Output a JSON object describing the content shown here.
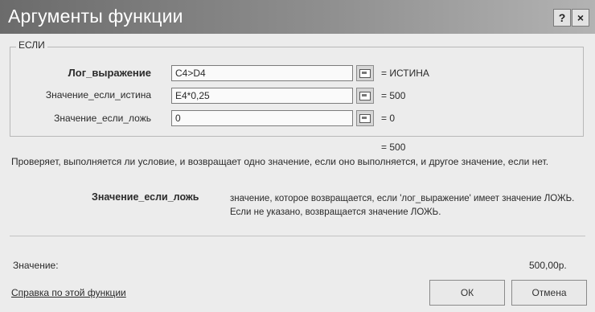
{
  "window": {
    "title": "Аргументы функции",
    "help_glyph": "?",
    "close_glyph": "×"
  },
  "function_group": {
    "name": "ЕСЛИ"
  },
  "arguments": [
    {
      "label": "Лог_выражение",
      "value": "C4>D4",
      "result": "= ИСТИНА",
      "bold": true
    },
    {
      "label": "Значение_если_истина",
      "value": "E4*0,25",
      "result": "= 500",
      "bold": false
    },
    {
      "label": "Значение_если_ложь",
      "value": "0",
      "result": "= 0",
      "bold": false
    }
  ],
  "formula_result": "= 500",
  "description": "Проверяет, выполняется ли условие, и возвращает одно значение, если оно выполняется, и другое значение, если нет.",
  "arg_help": {
    "name": "Значение_если_ложь",
    "text": "значение, которое возвращается, если 'лог_выражение' имеет значение ЛОЖЬ. Если не указано, возвращается значение ЛОЖЬ."
  },
  "value_label": "Значение:",
  "value_result": "500,00р.",
  "help_link": "Справка по этой функции",
  "buttons": {
    "ok": "ОК",
    "cancel": "Отмена"
  },
  "icons": {
    "collapse": "collapse-dialog-icon"
  },
  "colors": {
    "titlebar_dark": "#6b6b6b",
    "titlebar_light": "#b3b3b3",
    "dialog_bg": "#ececec"
  }
}
